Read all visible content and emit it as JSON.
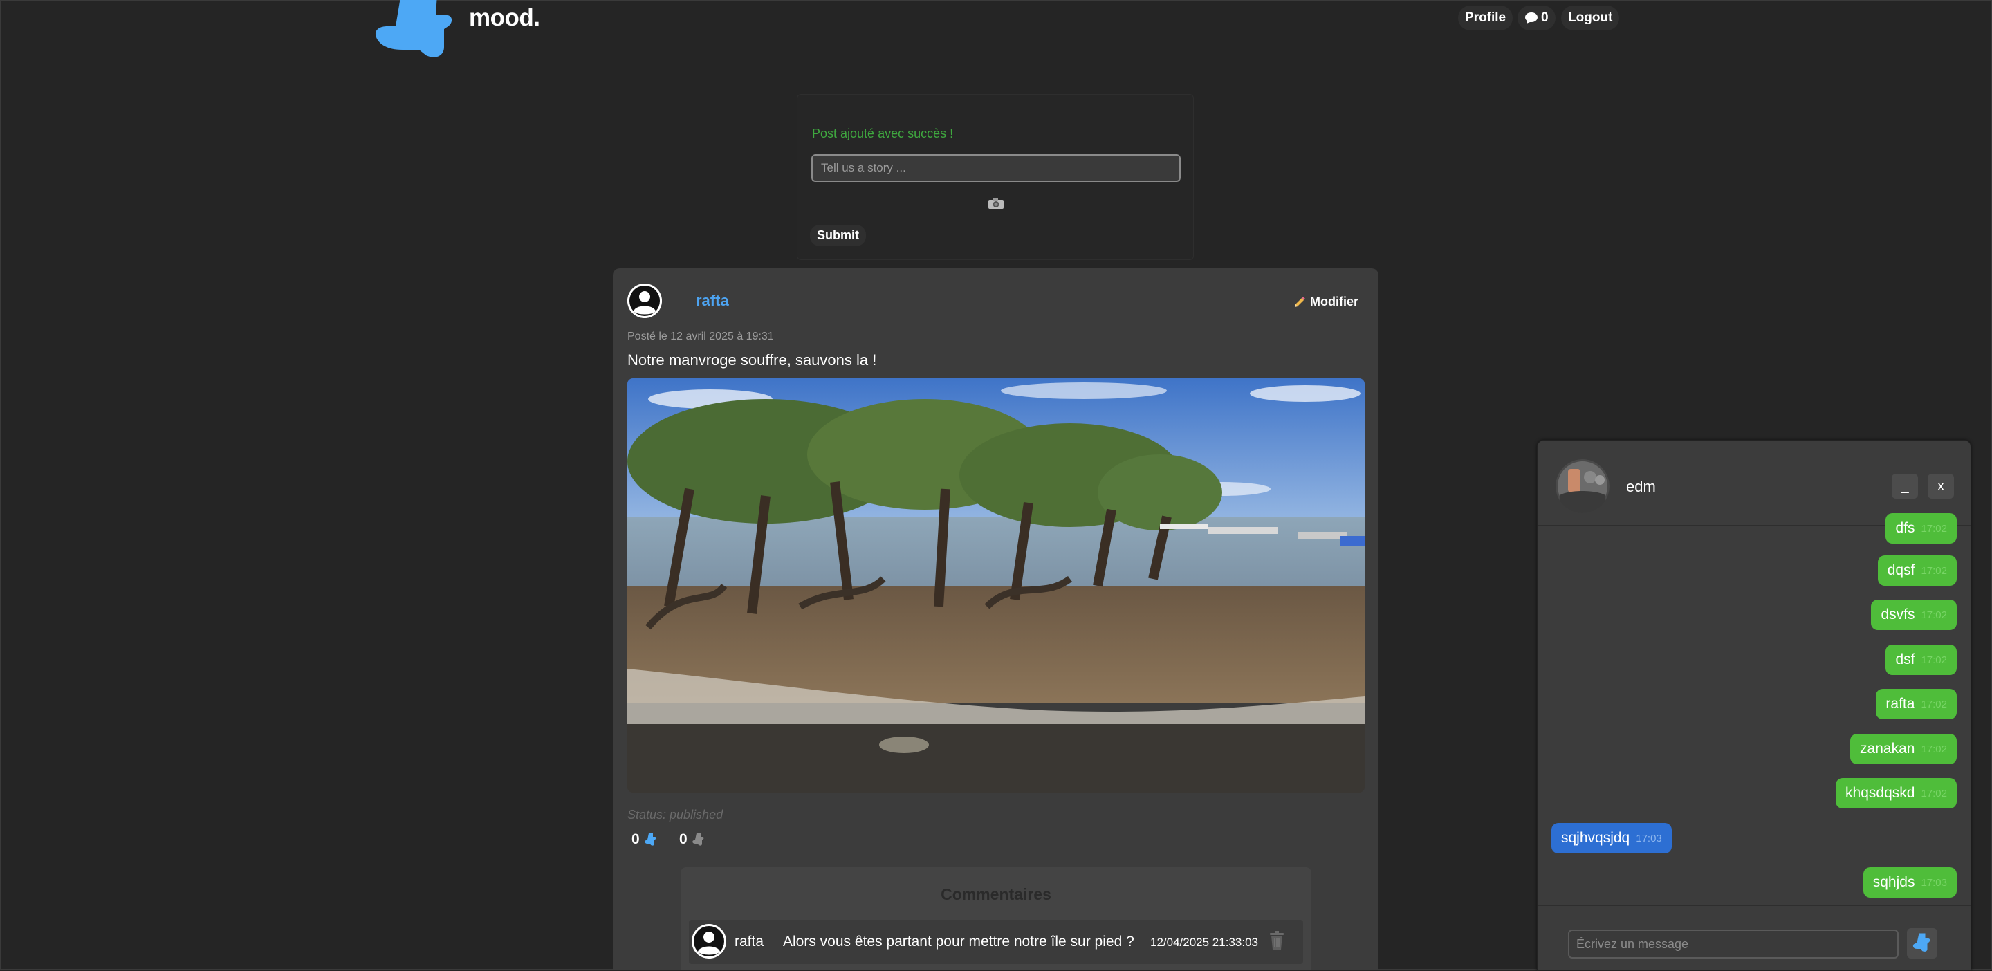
{
  "header": {
    "brand": "mood.",
    "nav": {
      "profile": "Profile",
      "message_count": "0",
      "logout": "Logout"
    }
  },
  "post_form": {
    "success_message": "Post ajouté avec succès !",
    "placeholder": "Tell us a story ...",
    "submit_label": "Submit"
  },
  "post": {
    "author": "rafta",
    "edit_label": "Modifier",
    "date": "Posté le 12 avril 2025 à 19:31",
    "content": "Notre manvroge souffre, sauvons la !",
    "status": "Status: published",
    "likes": "0",
    "dislikes": "0",
    "comments": {
      "title": "Commentaires",
      "items": [
        {
          "user": "rafta",
          "text": "Alors vous êtes partant pour mettre notre île sur pied ?",
          "date": "12/04/2025 21:33:03"
        }
      ]
    }
  },
  "chat": {
    "contact": "edm",
    "minimize_label": "_",
    "close_label": "x",
    "messages": [
      {
        "text": "dfs",
        "time": "17:02",
        "from": "me"
      },
      {
        "text": "dqsf",
        "time": "17:02",
        "from": "me"
      },
      {
        "text": "dsvfs",
        "time": "17:02",
        "from": "me"
      },
      {
        "text": "dsf",
        "time": "17:02",
        "from": "me"
      },
      {
        "text": "rafta",
        "time": "17:02",
        "from": "me"
      },
      {
        "text": "zanakan",
        "time": "17:02",
        "from": "me"
      },
      {
        "text": "khqsdqskd",
        "time": "17:02",
        "from": "me"
      },
      {
        "text": "sqjhvqsjdq",
        "time": "17:03",
        "from": "them"
      },
      {
        "text": "sqhjds",
        "time": "17:03",
        "from": "me"
      }
    ],
    "input_placeholder": "Écrivez un message"
  },
  "colors": {
    "accent": "#4da3f0",
    "sent_bubble": "#4fbd3a",
    "received_bubble": "#2d6fd3",
    "success": "#3fa83f",
    "background": "#252525"
  },
  "icons": [
    "mood-logo",
    "chat-bubble-icon",
    "pencil-icon",
    "camera-icon",
    "mood-like-icon",
    "mood-dislike-icon",
    "trash-icon",
    "send-icon",
    "user-avatar-icon"
  ]
}
